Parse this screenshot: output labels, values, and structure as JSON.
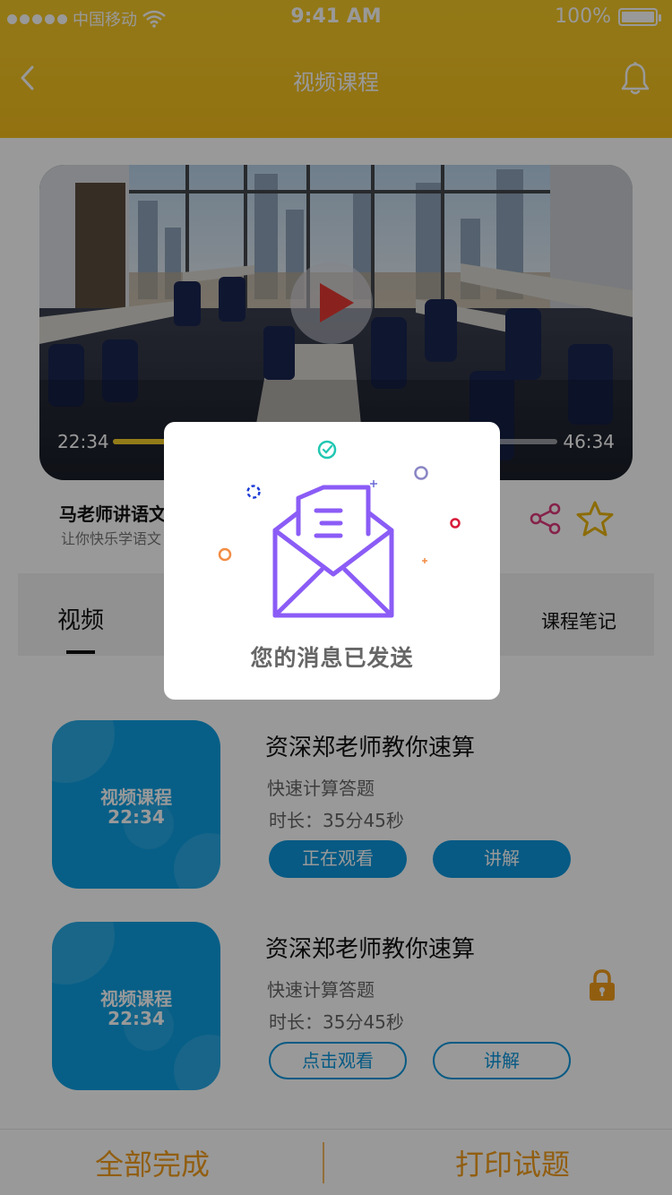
{
  "status_bar": {
    "carrier": "中国移动",
    "time": "9:41 AM",
    "battery": "100%"
  },
  "nav": {
    "title": "视频课程",
    "back_icon": "chevron-left-icon",
    "bell_icon": "bell-icon"
  },
  "player": {
    "current_time": "22:34",
    "total_time": "46:34",
    "progress": 0.485,
    "play_icon": "play-icon"
  },
  "course": {
    "title": "马老师讲语文",
    "subtitle": "让你快乐学语文",
    "share_icon": "share-icon",
    "star_icon": "star-icon"
  },
  "tabs": [
    {
      "label": "视频",
      "active": true
    },
    {
      "label": "课程笔记",
      "active": false
    }
  ],
  "lessons": [
    {
      "thumb_title": "视频课程",
      "thumb_time": "22:34",
      "title": "资深郑老师教你速算",
      "subtitle": "快速计算答题",
      "duration": "时长：35分45秒",
      "primary_button": "正在观看",
      "secondary_button": "讲解",
      "locked": false
    },
    {
      "thumb_title": "视频课程",
      "thumb_time": "22:34",
      "title": "资深郑老师教你速算",
      "subtitle": "快速计算答题",
      "duration": "时长：35分45秒",
      "primary_button": "点击观看",
      "secondary_button": "讲解",
      "locked": true
    }
  ],
  "bottom_bar": {
    "left": "全部完成",
    "right": "打印试题"
  },
  "modal": {
    "message": "您的消息已发送",
    "icon": "envelope-icon"
  },
  "colors": {
    "header": "#f5c623",
    "accent_blue": "#0c96dc",
    "accent_orange": "#f29d1b",
    "envelope_purple": "#8b5cf6",
    "play_red": "#e53a32"
  }
}
